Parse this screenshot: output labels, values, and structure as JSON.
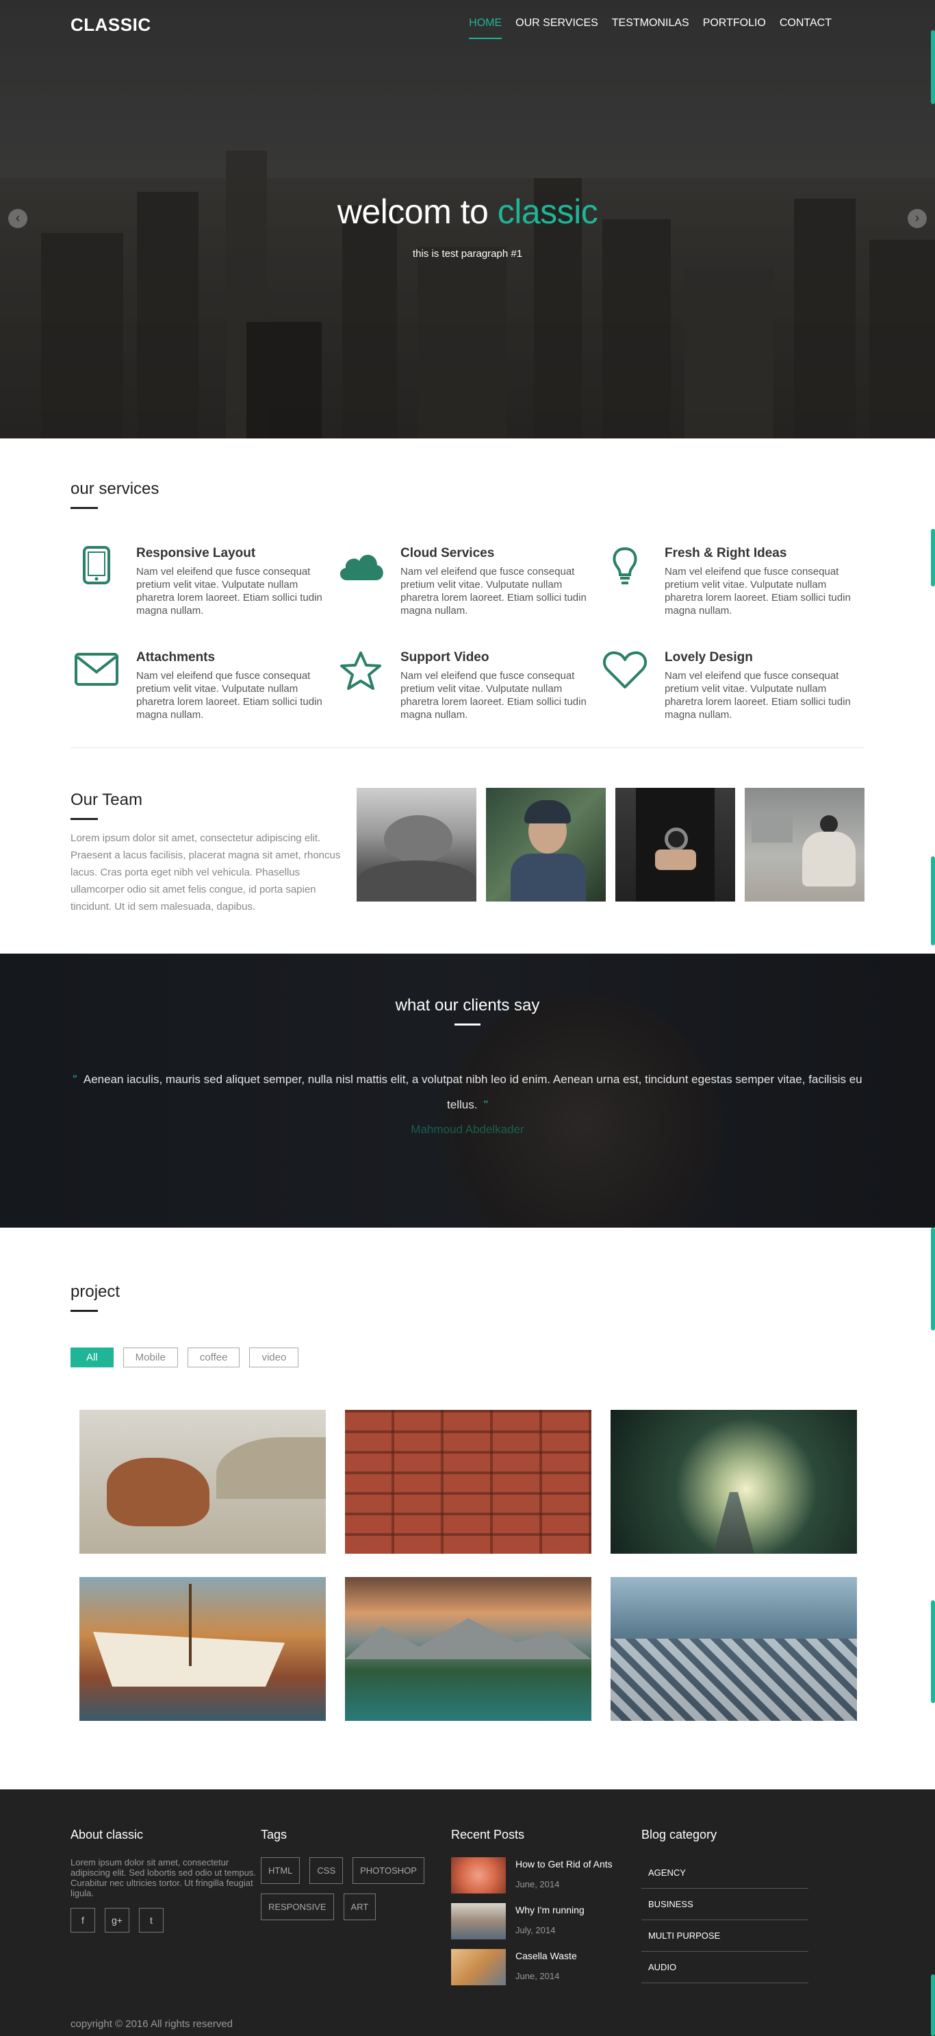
{
  "brand": "CLASSIC",
  "nav": [
    "HOME",
    "OUR SERVICES",
    "TESTMONILAS",
    "PORTFOLIO",
    "CONTACT"
  ],
  "hero": {
    "title_a": "welcom to ",
    "title_b": "classic",
    "subtitle": "this is test paragraph #1",
    "prev": "‹",
    "next": "›"
  },
  "services": {
    "title": "our services",
    "items": [
      {
        "icon": "tablet-icon",
        "title": "Responsive Layout",
        "text": "Nam vel eleifend que fusce consequat pretium velit vitae. Vulputate nullam pharetra lorem laoreet. Etiam sollici tudin magna nullam."
      },
      {
        "icon": "cloud-icon",
        "title": "Cloud Services",
        "text": "Nam vel eleifend que fusce consequat pretium velit vitae. Vulputate nullam pharetra lorem laoreet. Etiam sollici tudin magna nullam."
      },
      {
        "icon": "lightbulb-icon",
        "title": "Fresh & Right Ideas",
        "text": "Nam vel eleifend que fusce consequat pretium velit vitae. Vulputate nullam pharetra lorem laoreet. Etiam sollici tudin magna nullam."
      },
      {
        "icon": "envelope-icon",
        "title": "Attachments",
        "text": "Nam vel eleifend que fusce consequat pretium velit vitae. Vulputate nullam pharetra lorem laoreet. Etiam sollici tudin magna nullam."
      },
      {
        "icon": "star-icon",
        "title": "Support Video",
        "text": "Nam vel eleifend que fusce consequat pretium velit vitae. Vulputate nullam pharetra lorem laoreet. Etiam sollici tudin magna nullam."
      },
      {
        "icon": "heart-icon",
        "title": "Lovely Design",
        "text": "Nam vel eleifend que fusce consequat pretium velit vitae. Vulputate nullam pharetra lorem laoreet. Etiam sollici tudin magna nullam."
      }
    ]
  },
  "team": {
    "title": "Our Team",
    "text": "Lorem ipsum dolor sit amet, consectetur adipiscing elit. Praesent a lacus facilisis, placerat magna sit amet, rhoncus lacus. Cras porta eget nibh vel vehicula. Phasellus ullamcorper odio sit amet felis congue, id porta sapien tincidunt. Ut id sem malesuada, dapibus."
  },
  "testimonial": {
    "title": "what our clients say",
    "quote": "Aenean iaculis, mauris sed aliquet semper, nulla nisl mattis elit, a volutpat nibh leo id enim. Aenean urna est, tincidunt egestas semper vitae, facilisis eu tellus.",
    "open_quote": "\"",
    "close_quote": "\"",
    "author": "Mahmoud Abdelkader"
  },
  "project": {
    "title": "project",
    "filters": [
      "All",
      "Mobile",
      "coffee",
      "video"
    ]
  },
  "footer": {
    "about_title": "About classic",
    "about_text": "Lorem ipsum dolor sit amet, consectetur adipiscing elit. Sed lobortis sed odio ut tempus. Curabitur nec ultricies tortor. Ut fringilla feugiat ligula.",
    "social": [
      "f",
      "g+",
      "t"
    ],
    "tags_title": "Tags",
    "tags": [
      "HTML",
      "CSS",
      "PHOTOSHOP",
      "RESPONSIVE",
      "ART"
    ],
    "posts_title": "Recent Posts",
    "posts": [
      {
        "title": "How to Get Rid of Ants",
        "date": "June, 2014"
      },
      {
        "title": "Why I'm running",
        "date": "July, 2014"
      },
      {
        "title": "Casella Waste",
        "date": "June, 2014"
      }
    ],
    "category_title": "Blog category",
    "categories": [
      "AGENCY",
      "BUSINESS",
      "MULTI PURPOSE",
      "AUDIO"
    ],
    "copyright": "copyright © 2016 All rights reserved"
  },
  "colors": {
    "accent": "#1fb597",
    "icon": "#2b8068",
    "footer_bg": "#222222"
  }
}
